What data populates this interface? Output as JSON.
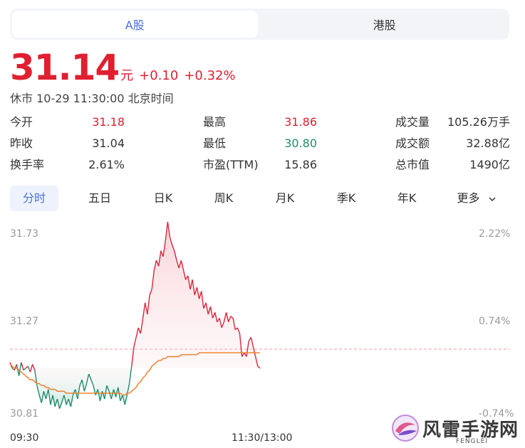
{
  "market_tabs": [
    {
      "label": "A股",
      "active": true
    },
    {
      "label": "港股",
      "active": false
    }
  ],
  "quote": {
    "price": "31.14",
    "unit": "元",
    "change": "+0.10",
    "change_pct": "+0.32%",
    "status": "休市 10-29 11:30:00 北京时间",
    "color_up": "#e01f30",
    "color_down": "#1f8a6c"
  },
  "stats": [
    {
      "label": "今开",
      "value": "31.18",
      "color": "#e01f30"
    },
    {
      "label": "最高",
      "value": "31.86",
      "color": "#e01f30"
    },
    {
      "label": "成交量",
      "value": "105.26万手",
      "color": "#333333"
    },
    {
      "label": "昨收",
      "value": "31.04",
      "color": "#333333"
    },
    {
      "label": "最低",
      "value": "30.80",
      "color": "#1f8a6c"
    },
    {
      "label": "成交额",
      "value": "32.88亿",
      "color": "#333333"
    },
    {
      "label": "换手率",
      "value": "2.61%",
      "color": "#333333"
    },
    {
      "label": "市盈(TTM)",
      "value": "15.86",
      "color": "#333333"
    },
    {
      "label": "总市值",
      "value": "1490亿",
      "color": "#333333"
    }
  ],
  "period_tabs": [
    {
      "label": "分时",
      "active": true
    },
    {
      "label": "五日",
      "active": false
    },
    {
      "label": "日K",
      "active": false
    },
    {
      "label": "周K",
      "active": false
    },
    {
      "label": "月K",
      "active": false
    },
    {
      "label": "季K",
      "active": false
    },
    {
      "label": "年K",
      "active": false
    },
    {
      "label": "更多",
      "active": false
    }
  ],
  "watermark": {
    "text": "风雷手游网",
    "sub": "FENGLEI"
  },
  "chart_data": {
    "type": "line",
    "title": "",
    "y_ticks_left": [
      "31.73",
      "31.27",
      "30.81"
    ],
    "y_ticks_right": [
      "2.22%",
      "0.74%",
      "-0.74%"
    ],
    "x_ticks": [
      "09:30",
      "11:30/13:00"
    ],
    "ylim": [
      30.81,
      31.73
    ],
    "prev_close": 31.04,
    "series": [
      {
        "role": "price",
        "color_up": "#d7263d",
        "color_down": "#1f8a6c",
        "values": [
          31.07,
          31.04,
          31.03,
          31.06,
          31.0,
          31.07,
          31.03,
          31.04,
          31.05,
          31.02,
          31.06,
          31.03,
          30.95,
          30.9,
          30.86,
          30.92,
          30.88,
          30.93,
          30.85,
          30.9,
          30.84,
          30.88,
          30.83,
          30.86,
          30.9,
          30.85,
          30.88,
          30.84,
          30.9,
          30.93,
          30.88,
          30.95,
          30.98,
          30.92,
          30.96,
          31.01,
          30.98,
          30.95,
          30.9,
          30.93,
          30.87,
          30.92,
          30.88,
          30.95,
          30.92,
          30.88,
          30.93,
          30.89,
          30.94,
          30.87,
          30.9,
          30.85,
          30.9,
          30.96,
          31.05,
          31.15,
          31.2,
          31.25,
          31.22,
          31.3,
          31.38,
          31.32,
          31.42,
          31.45,
          31.55,
          31.6,
          31.57,
          31.65,
          31.62,
          31.7,
          31.8,
          31.72,
          31.68,
          31.65,
          31.6,
          31.56,
          31.6,
          31.55,
          31.5,
          31.52,
          31.45,
          31.5,
          31.42,
          31.46,
          31.4,
          31.44,
          31.35,
          31.38,
          31.32,
          31.36,
          31.3,
          31.33,
          31.28,
          31.3,
          31.25,
          31.28,
          31.33,
          31.28,
          31.31,
          31.3,
          31.24,
          31.25,
          31.22,
          31.1,
          31.12,
          31.1,
          31.18,
          31.2,
          31.15,
          31.1,
          31.05,
          31.04
        ]
      },
      {
        "role": "average",
        "color": "#f07a22",
        "values": [
          31.06,
          31.05,
          31.04,
          31.04,
          31.03,
          31.02,
          31.01,
          31.0,
          30.99,
          30.98,
          30.98,
          30.97,
          30.96,
          30.96,
          30.95,
          30.95,
          30.94,
          30.94,
          30.93,
          30.93,
          30.93,
          30.92,
          30.92,
          30.92,
          30.92,
          30.91,
          30.91,
          30.91,
          30.91,
          30.91,
          30.91,
          30.91,
          30.91,
          30.91,
          30.91,
          30.91,
          30.91,
          30.91,
          30.91,
          30.91,
          30.91,
          30.91,
          30.91,
          30.91,
          30.91,
          30.91,
          30.91,
          30.91,
          30.91,
          30.91,
          30.9,
          30.9,
          30.91,
          30.91,
          30.92,
          30.93,
          30.94,
          30.96,
          30.97,
          30.99,
          31.0,
          31.02,
          31.03,
          31.05,
          31.06,
          31.07,
          31.08,
          31.08,
          31.09,
          31.09,
          31.1,
          31.1,
          31.1,
          31.1,
          31.1,
          31.1,
          31.11,
          31.11,
          31.11,
          31.11,
          31.11,
          31.11,
          31.11,
          31.11,
          31.12,
          31.12,
          31.12,
          31.12,
          31.12,
          31.12,
          31.12,
          31.12,
          31.12,
          31.12,
          31.12,
          31.12,
          31.12,
          31.12,
          31.12,
          31.12,
          31.12,
          31.12,
          31.12,
          31.12,
          31.12,
          31.12,
          31.12,
          31.12,
          31.12,
          31.12,
          31.12,
          31.12
        ]
      }
    ]
  }
}
